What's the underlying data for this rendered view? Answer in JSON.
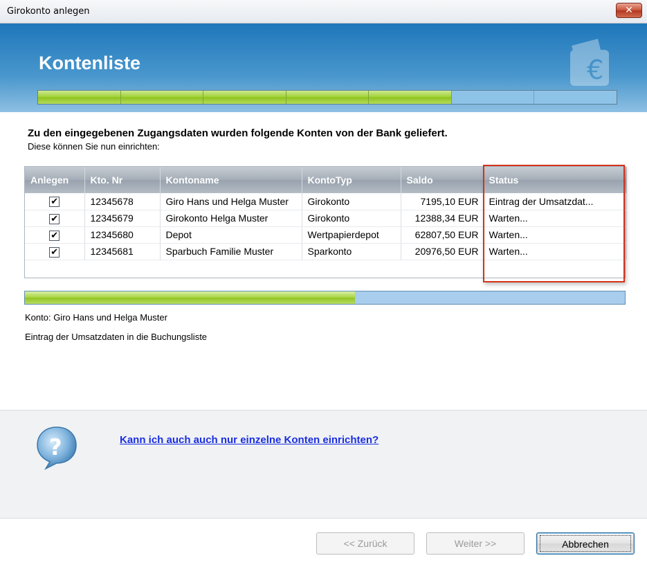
{
  "window": {
    "title": "Girokonto anlegen",
    "close_glyph": "✕"
  },
  "header": {
    "title": "Kontenliste",
    "wizard_steps_total": 7,
    "wizard_steps_done": 5,
    "icon": "euro-wallet-icon"
  },
  "intro": {
    "headline": "Zu den eingegebenen Zugangsdaten wurden folgende Konten von der Bank geliefert.",
    "subline": "Diese können Sie nun einrichten:"
  },
  "table": {
    "columns": [
      "Anlegen",
      "Kto. Nr",
      "Kontoname",
      "KontoTyp",
      "Saldo",
      "Status"
    ],
    "rows": [
      {
        "checked": true,
        "check_glyph": "✔",
        "kto": "12345678",
        "name": "Giro Hans und Helga Muster",
        "typ": "Girokonto",
        "saldo": "7195,10 EUR",
        "status": "Eintrag der Umsatzdat..."
      },
      {
        "checked": true,
        "check_glyph": "✔",
        "kto": "12345679",
        "name": "Girokonto Helga Muster",
        "typ": "Girokonto",
        "saldo": "12388,34 EUR",
        "status": "Warten..."
      },
      {
        "checked": true,
        "check_glyph": "✔",
        "kto": "12345680",
        "name": "Depot",
        "typ": "Wertpapierdepot",
        "saldo": "62807,50 EUR",
        "status": "Warten..."
      },
      {
        "checked": true,
        "check_glyph": "✔",
        "kto": "12345681",
        "name": "Sparbuch Familie Muster",
        "typ": "Sparkonto",
        "saldo": "20976,50 EUR",
        "status": "Warten..."
      }
    ]
  },
  "progress": {
    "fraction": 0.55
  },
  "status": {
    "line1": "Konto: Giro Hans und Helga Muster",
    "line2": "Eintrag der Umsatzdaten in die Buchungsliste"
  },
  "help": {
    "icon": "question-bubble-icon",
    "link": "Kann ich auch auch nur einzelne Konten einrichten?"
  },
  "buttons": {
    "back": "<< Zurück",
    "next": "Weiter >>",
    "cancel": "Abbrechen"
  },
  "colors": {
    "header_blue": "#1e77ba",
    "progress_green": "#9ed032",
    "highlight_red": "#d6311a",
    "link_blue": "#1a2ee0"
  }
}
